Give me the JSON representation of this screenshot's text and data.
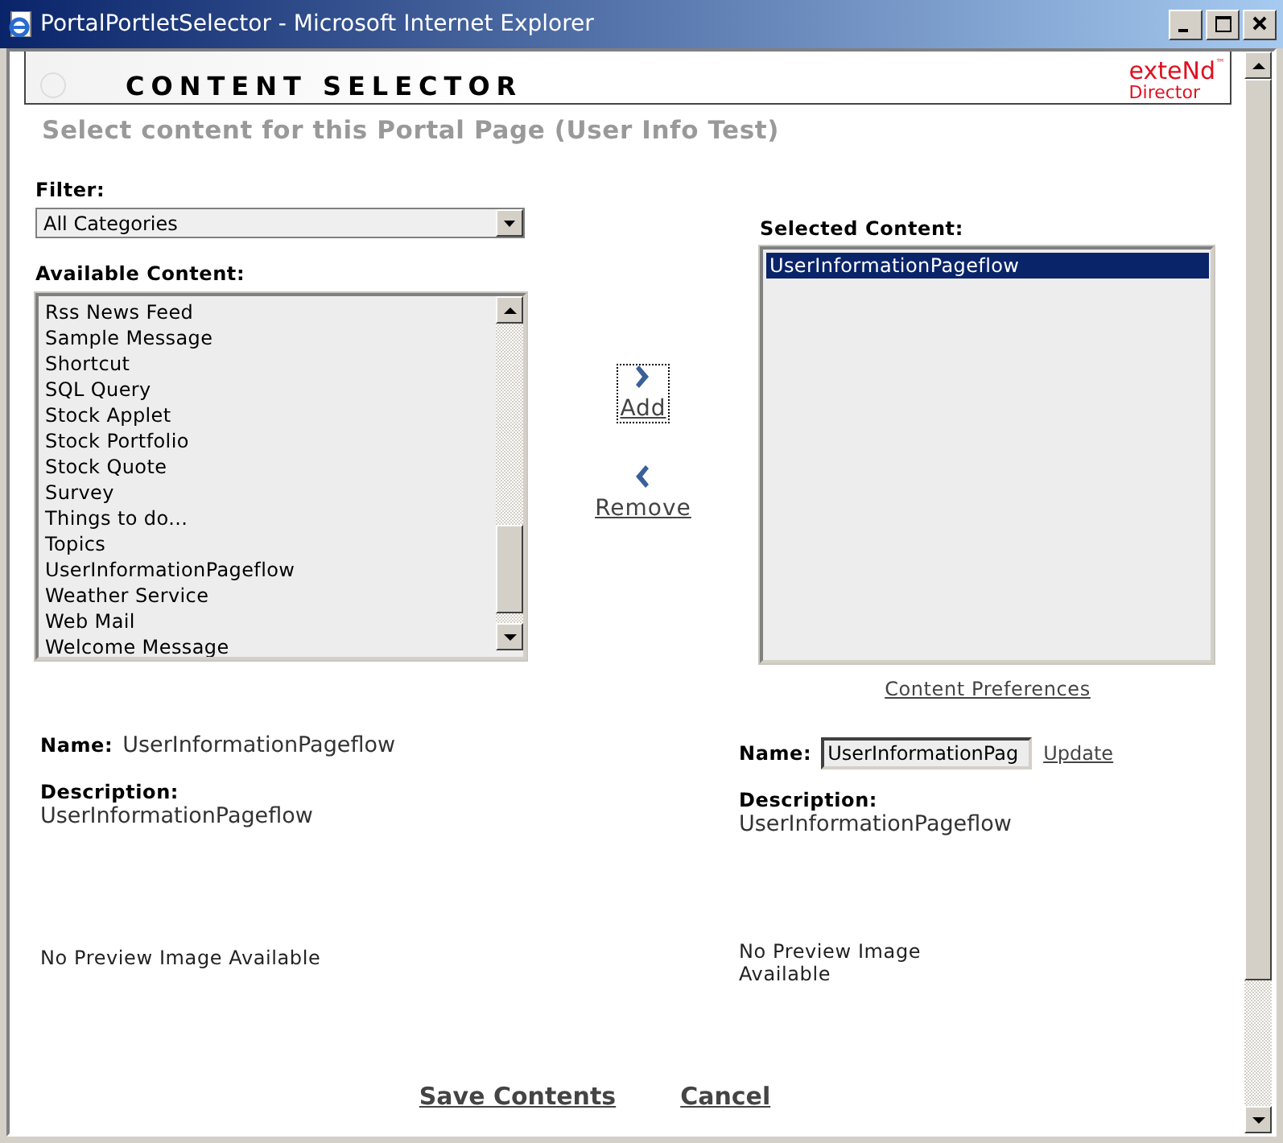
{
  "window": {
    "title": "PortalPortletSelector - Microsoft Internet Explorer"
  },
  "header": {
    "title": "CONTENT SELECTOR",
    "logo_name": "exteNd",
    "logo_mark": "™",
    "logo_sub": "Director"
  },
  "subtitle": "Select content for this Portal Page (User Info Test)",
  "filter": {
    "label": "Filter:",
    "value": "All Categories"
  },
  "available": {
    "label": "Available Content:",
    "items": [
      {
        "text": "Rss News Feed",
        "selected": false
      },
      {
        "text": "Sample Message",
        "selected": false
      },
      {
        "text": "Shortcut",
        "selected": false
      },
      {
        "text": "SQL Query",
        "selected": false
      },
      {
        "text": "Stock Applet",
        "selected": false
      },
      {
        "text": "Stock Portfolio",
        "selected": false
      },
      {
        "text": "Stock Quote",
        "selected": false
      },
      {
        "text": "Survey",
        "selected": false
      },
      {
        "text": "Things to do...",
        "selected": false
      },
      {
        "text": "Topics",
        "selected": false
      },
      {
        "text": "UserInformationPageflow",
        "selected": false
      },
      {
        "text": "Weather Service",
        "selected": false
      },
      {
        "text": "Web Mail",
        "selected": false
      },
      {
        "text": "Welcome Message",
        "selected": false
      }
    ]
  },
  "actions": [
    {
      "kind": "add",
      "label": "Add",
      "focused": true
    },
    {
      "kind": "remove",
      "label": "Remove",
      "focused": false
    }
  ],
  "selected_content": {
    "label": "Selected Content:",
    "items": [
      {
        "text": "UserInformationPageflow",
        "selected": true
      }
    ],
    "preferences_link": "Content Preferences"
  },
  "left_details": {
    "name_label": "Name:",
    "name": "UserInformationPageflow",
    "description_label": "Description:",
    "description": "UserInformationPageflow",
    "preview": "No Preview Image Available"
  },
  "right_details": {
    "name_label": "Name:",
    "name_value": "UserInformationPag",
    "update_link": "Update",
    "description_label": "Description:",
    "description": "UserInformationPageflow",
    "preview": "No Preview Image Available"
  },
  "footer": [
    "Save Contents",
    "Cancel"
  ]
}
